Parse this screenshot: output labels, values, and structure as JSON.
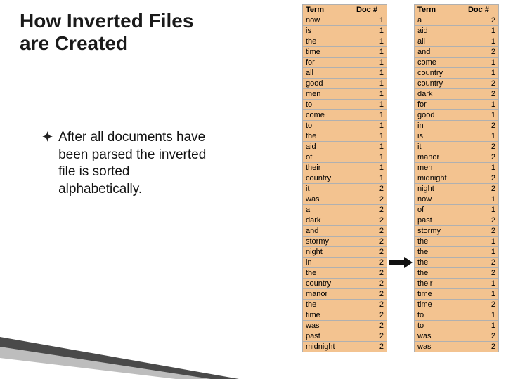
{
  "title": "How Inverted Files are Created",
  "bullet": "After all documents have been parsed the inverted file is sorted alphabetically.",
  "table_headers": {
    "term": "Term",
    "doc": "Doc #"
  },
  "left_table": [
    {
      "term": "now",
      "doc": 1
    },
    {
      "term": "is",
      "doc": 1
    },
    {
      "term": "the",
      "doc": 1
    },
    {
      "term": "time",
      "doc": 1
    },
    {
      "term": "for",
      "doc": 1
    },
    {
      "term": "all",
      "doc": 1
    },
    {
      "term": "good",
      "doc": 1
    },
    {
      "term": "men",
      "doc": 1
    },
    {
      "term": "to",
      "doc": 1
    },
    {
      "term": "come",
      "doc": 1
    },
    {
      "term": "to",
      "doc": 1
    },
    {
      "term": "the",
      "doc": 1
    },
    {
      "term": "aid",
      "doc": 1
    },
    {
      "term": "of",
      "doc": 1
    },
    {
      "term": "their",
      "doc": 1
    },
    {
      "term": "country",
      "doc": 1
    },
    {
      "term": "it",
      "doc": 2
    },
    {
      "term": "was",
      "doc": 2
    },
    {
      "term": "a",
      "doc": 2
    },
    {
      "term": "dark",
      "doc": 2
    },
    {
      "term": "and",
      "doc": 2
    },
    {
      "term": "stormy",
      "doc": 2
    },
    {
      "term": "night",
      "doc": 2
    },
    {
      "term": "in",
      "doc": 2
    },
    {
      "term": "the",
      "doc": 2
    },
    {
      "term": "country",
      "doc": 2
    },
    {
      "term": "manor",
      "doc": 2
    },
    {
      "term": "the",
      "doc": 2
    },
    {
      "term": "time",
      "doc": 2
    },
    {
      "term": "was",
      "doc": 2
    },
    {
      "term": "past",
      "doc": 2
    },
    {
      "term": "midnight",
      "doc": 2
    }
  ],
  "right_table": [
    {
      "term": "a",
      "doc": 2
    },
    {
      "term": "aid",
      "doc": 1
    },
    {
      "term": "all",
      "doc": 1
    },
    {
      "term": "and",
      "doc": 2
    },
    {
      "term": "come",
      "doc": 1
    },
    {
      "term": "country",
      "doc": 1
    },
    {
      "term": "country",
      "doc": 2
    },
    {
      "term": "dark",
      "doc": 2
    },
    {
      "term": "for",
      "doc": 1
    },
    {
      "term": "good",
      "doc": 1
    },
    {
      "term": "in",
      "doc": 2
    },
    {
      "term": "is",
      "doc": 1
    },
    {
      "term": "it",
      "doc": 2
    },
    {
      "term": "manor",
      "doc": 2
    },
    {
      "term": "men",
      "doc": 1
    },
    {
      "term": "midnight",
      "doc": 2
    },
    {
      "term": "night",
      "doc": 2
    },
    {
      "term": "now",
      "doc": 1
    },
    {
      "term": "of",
      "doc": 1
    },
    {
      "term": "past",
      "doc": 2
    },
    {
      "term": "stormy",
      "doc": 2
    },
    {
      "term": "the",
      "doc": 1
    },
    {
      "term": "the",
      "doc": 1
    },
    {
      "term": "the",
      "doc": 2
    },
    {
      "term": "the",
      "doc": 2
    },
    {
      "term": "their",
      "doc": 1
    },
    {
      "term": "time",
      "doc": 1
    },
    {
      "term": "time",
      "doc": 2
    },
    {
      "term": "to",
      "doc": 1
    },
    {
      "term": "to",
      "doc": 1
    },
    {
      "term": "was",
      "doc": 2
    },
    {
      "term": "was",
      "doc": 2
    }
  ]
}
